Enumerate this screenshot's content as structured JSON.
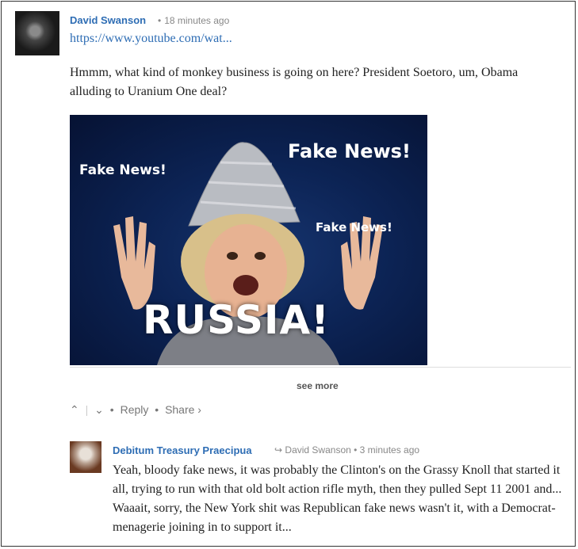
{
  "comment1": {
    "author": "David Swanson",
    "time": "18 minutes ago",
    "link": "https://www.youtube.com/wat...",
    "text": "Hmmm, what kind of monkey business is going on here? President Soetoro, um, Obama alluding to Uranium One deal?",
    "image": {
      "text1": "Fake News!",
      "text2": "Fake News!",
      "text3": "Fake News!",
      "text4": "RUSSIA!"
    },
    "see_more": "see more",
    "reply": "Reply",
    "share": "Share ›"
  },
  "comment2": {
    "author": "Debitum Treasury Praecipua",
    "reply_to": "David Swanson",
    "time": "3 minutes ago",
    "text": "Yeah, bloody fake news, it was probably the Clinton's on the Grassy Knoll that started it all, trying to run with that old bolt action rifle myth, then they pulled Sept 11 2001 and... Waaait, sorry, the New York shit was Republican fake news wasn't it, with a Democrat-menagerie joining in to support it..."
  }
}
